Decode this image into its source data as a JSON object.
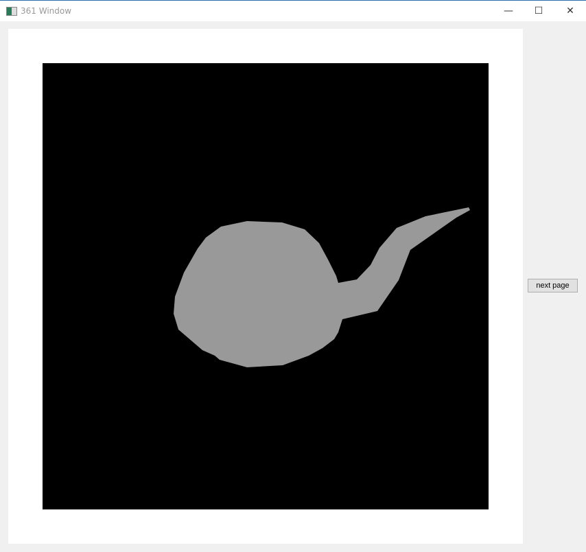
{
  "window": {
    "title": "361 Window",
    "minimize_icon": "minimize-icon",
    "maximize_icon": "maximize-icon",
    "close_icon": "close-icon"
  },
  "canvas": {
    "background": "#000000",
    "shape_color": "#999999",
    "shape": "teapot silhouette"
  },
  "controls": {
    "next_label": "next page"
  }
}
